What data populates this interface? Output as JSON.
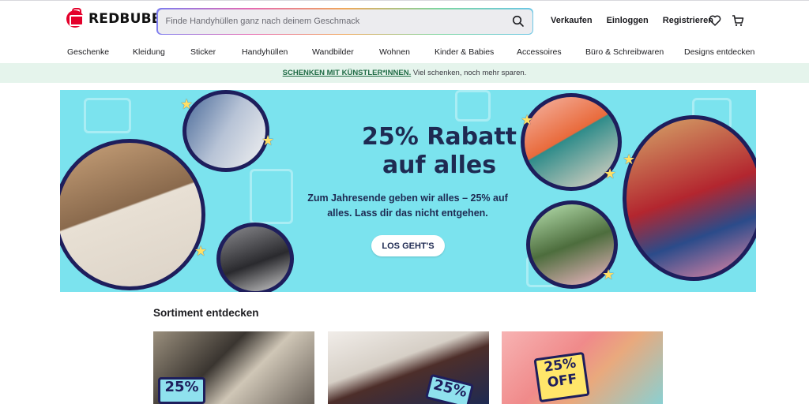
{
  "brand": {
    "name": "REDBUBBLE",
    "accent": "#e4002b"
  },
  "search": {
    "placeholder": "Finde Handyhüllen ganz nach deinem Geschmack"
  },
  "header_links": [
    "Verkaufen",
    "Einloggen",
    "Registrieren"
  ],
  "header_icons": [
    "heart-icon",
    "cart-icon"
  ],
  "nav": [
    "Geschenke",
    "Kleidung",
    "Sticker",
    "Handyhüllen",
    "Wandbilder",
    "Wohnen",
    "Kinder & Babies",
    "Accessoires",
    "Büro & Schreibwaren",
    "Designs entdecken"
  ],
  "promo": {
    "link": "SCHENKEN MIT KÜNSTLER*INNEN.",
    "text": "Viel schenken, noch mehr sparen."
  },
  "hero": {
    "title": "25% Rabatt auf alles",
    "subtitle": "Zum Jahresende geben wir alles – 25% auf alles. Lass dir das nicht entgehen.",
    "button": "LOS GEHT'S",
    "background": "#7be3ee"
  },
  "section": {
    "title": "Sortiment entdecken"
  },
  "cards": [
    {
      "badge": "25%"
    },
    {
      "badge": "25%"
    },
    {
      "badge": "25% OFF"
    }
  ]
}
